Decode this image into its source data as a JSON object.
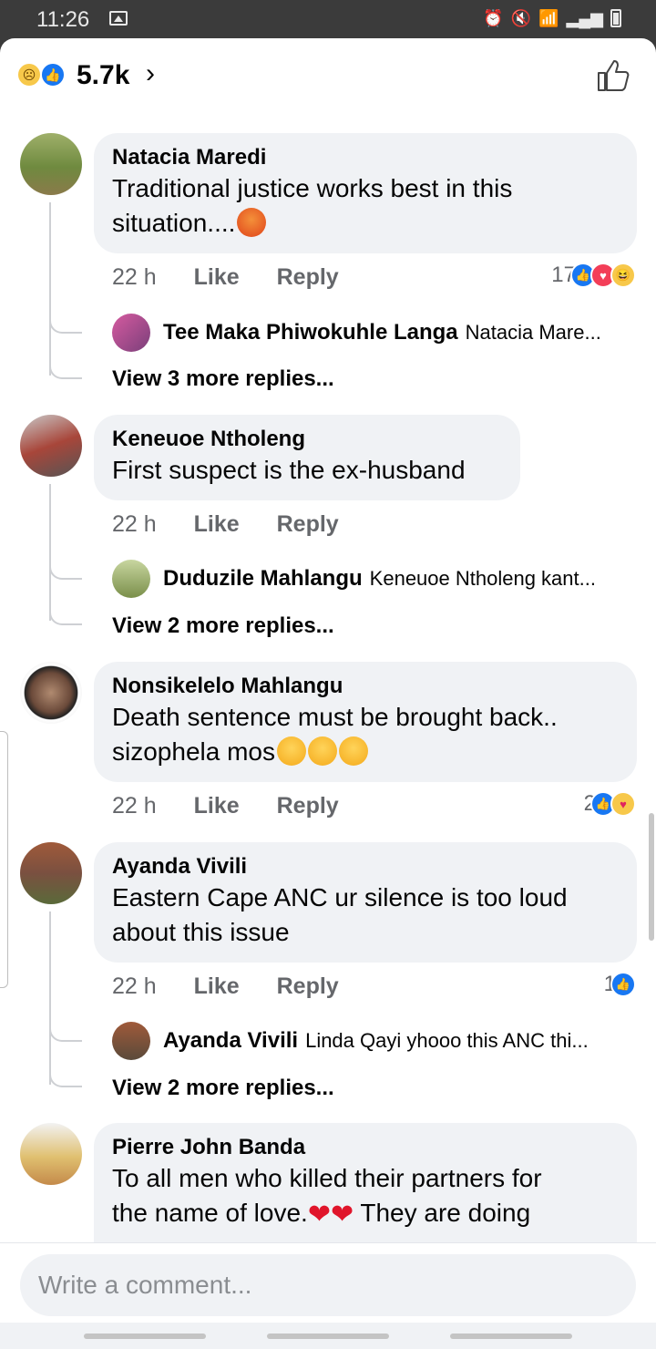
{
  "status": {
    "time": "11:26"
  },
  "header": {
    "reaction_count": "5.7k"
  },
  "comments": [
    {
      "name": "Natacia Maredi",
      "text1": "Traditional justice works best in this",
      "text2": "situation....",
      "time": "22 h",
      "like": "Like",
      "reply": "Reply",
      "reactions": "17",
      "reply_preview": {
        "name": "Tee Maka Phiwokuhle Langa",
        "text": "Natacia Mare..."
      },
      "more": "View 3 more replies..."
    },
    {
      "name": "Keneuoe Ntholeng",
      "text1": "First suspect is the ex-husband",
      "time": "22 h",
      "like": "Like",
      "reply": "Reply",
      "reply_preview": {
        "name": "Duduzile Mahlangu",
        "text": "Keneuoe Ntholeng kant..."
      },
      "more": "View 2 more replies..."
    },
    {
      "name": "Nonsikelelo Mahlangu",
      "text1": "Death sentence must be brought back..",
      "text2": "sizophela mos",
      "time": "22 h",
      "like": "Like",
      "reply": "Reply",
      "reactions": "2"
    },
    {
      "name": "Ayanda Vivili",
      "text1": "Eastern Cape ANC ur silence is too loud",
      "text2": "about  this issue",
      "time": "22 h",
      "like": "Like",
      "reply": "Reply",
      "reactions": "1",
      "reply_preview": {
        "name": "Ayanda Vivili",
        "text": "Linda Qayi yhooo this ANC thi..."
      },
      "more": "View 2 more replies..."
    },
    {
      "name": "Pierre John Banda",
      "text1": "To all men who killed their partners for",
      "text2": "the name of love.",
      "text3": " They are doing"
    }
  ],
  "composer": {
    "placeholder": "Write a comment..."
  }
}
